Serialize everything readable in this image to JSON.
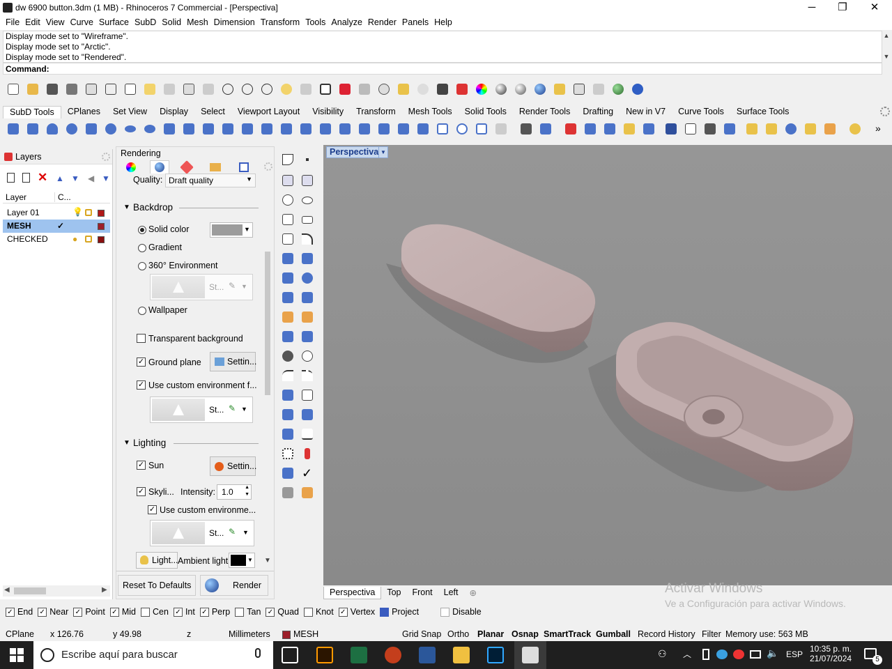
{
  "window": {
    "title": "dw 6900 button.3dm (1 MB) - Rhinoceros 7 Commercial - [Perspectiva]",
    "minimize": "─",
    "maximize": "❐",
    "close": "✕"
  },
  "menu": [
    "File",
    "Edit",
    "View",
    "Curve",
    "Surface",
    "SubD",
    "Solid",
    "Mesh",
    "Dimension",
    "Transform",
    "Tools",
    "Analyze",
    "Render",
    "Panels",
    "Help"
  ],
  "command": {
    "history": [
      "Display mode set to \"Wireframe\".",
      "Display mode set to \"Arctic\".",
      "Display mode set to \"Rendered\"."
    ],
    "prompt": "Command:"
  },
  "toolbar_tabs": [
    "SubD Tools",
    "CPlanes",
    "Set View",
    "Display",
    "Select",
    "Viewport Layout",
    "Visibility",
    "Transform",
    "Mesh Tools",
    "Solid Tools",
    "Render Tools",
    "Drafting",
    "New in V7",
    "Curve Tools",
    "Surface Tools"
  ],
  "layers_panel": {
    "title": "Layers",
    "col_layer": "Layer",
    "col_current": "C...",
    "rows": [
      {
        "name": "Layer 01",
        "current": "",
        "color": "#b01818"
      },
      {
        "name": "MESH",
        "current": "✓",
        "color": "#9c1f2a"
      },
      {
        "name": "CHECKED",
        "current": "",
        "color": "#8a1010"
      }
    ]
  },
  "rendering_panel": {
    "title": "Rendering",
    "quality_label": "Quality:",
    "quality_value": "Draft quality",
    "backdrop": {
      "heading": "Backdrop",
      "solid_color": "Solid color",
      "gradient": "Gradient",
      "environment": "360° Environment",
      "env_name": "St...",
      "wallpaper": "Wallpaper",
      "transparent": "Transparent background",
      "ground_plane": "Ground plane",
      "ground_settings": "Settin...",
      "custom_env": "Use custom environment f...",
      "custom_env_name": "St..."
    },
    "lighting": {
      "heading": "Lighting",
      "sun": "Sun",
      "sun_settings": "Settin...",
      "skylight": "Skyli...",
      "intensity_label": "Intensity:",
      "intensity_value": "1.0",
      "custom_env": "Use custom environme...",
      "custom_env_name": "St...",
      "light_btn": "Light...",
      "ambient_label": "Ambient light:"
    },
    "reset_button": "Reset To Defaults",
    "render_button": "Render"
  },
  "viewport": {
    "title": "Perspectiva",
    "tabs": [
      "Perspectiva",
      "Top",
      "Front",
      "Left"
    ],
    "add_tab": "⊕",
    "background": "#8e8e8e"
  },
  "osnap": [
    {
      "label": "End",
      "checked": true
    },
    {
      "label": "Near",
      "checked": true
    },
    {
      "label": "Point",
      "checked": true
    },
    {
      "label": "Mid",
      "checked": true
    },
    {
      "label": "Cen",
      "checked": false
    },
    {
      "label": "Int",
      "checked": true
    },
    {
      "label": "Perp",
      "checked": true
    },
    {
      "label": "Tan",
      "checked": false
    },
    {
      "label": "Quad",
      "checked": true
    },
    {
      "label": "Knot",
      "checked": false
    },
    {
      "label": "Vertex",
      "checked": true
    },
    {
      "label": "Project",
      "checked": false
    },
    {
      "label": "Disable",
      "checked": false
    }
  ],
  "status": {
    "cplane": "CPlane",
    "x": "x 126.76",
    "y": "y 49.98",
    "z": "z",
    "units": "Millimeters",
    "layer": "MESH",
    "grid_snap": "Grid Snap",
    "ortho": "Ortho",
    "planar": "Planar",
    "osnap": "Osnap",
    "smarttrack": "SmartTrack",
    "gumball": "Gumball",
    "record_history": "Record History",
    "filter": "Filter",
    "memory": "Memory use: 563 MB"
  },
  "watermark": {
    "line1": "Activar Windows",
    "line2": "Ve a Configuración para activar Windows."
  },
  "taskbar": {
    "search_placeholder": "Escribe aquí para buscar",
    "lang": "ESP",
    "time": "10:35 p. m.",
    "date": "21/07/2024",
    "notifications": "5"
  }
}
